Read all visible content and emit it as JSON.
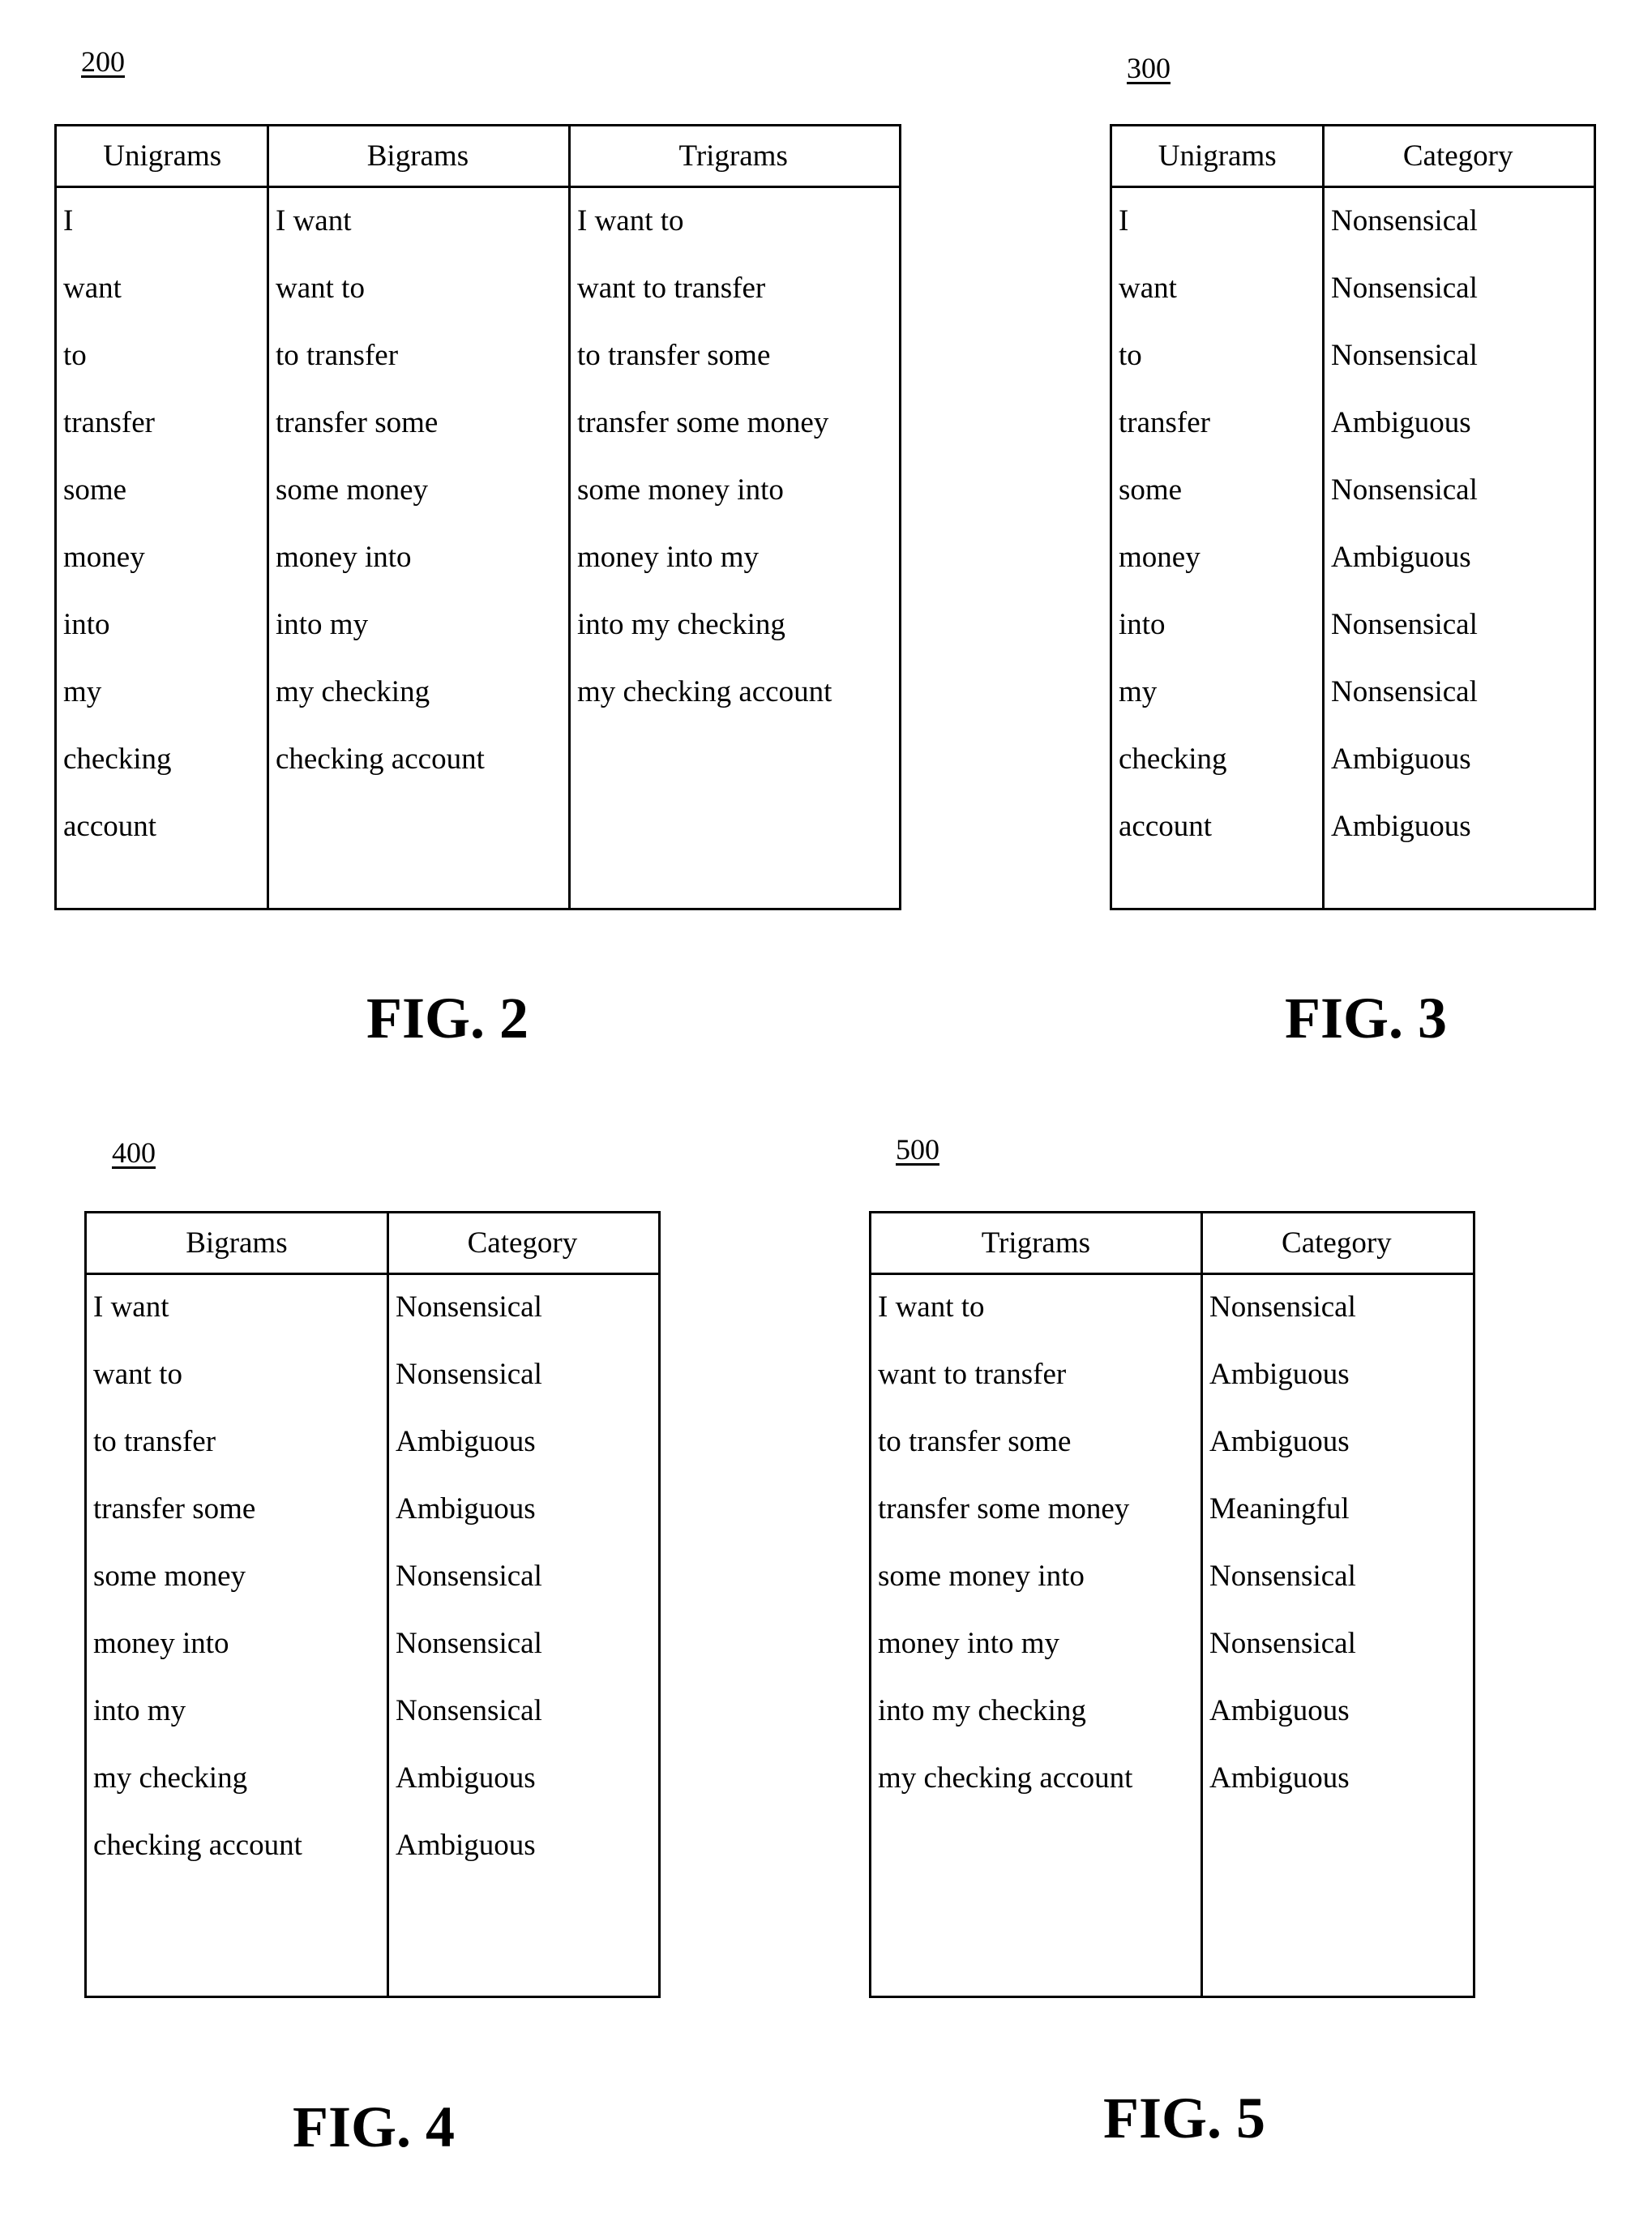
{
  "figures": [
    {
      "ref": "200",
      "caption": "FIG. 2",
      "headers": [
        "Unigrams",
        "Bigrams",
        "Trigrams"
      ],
      "columns": [
        [
          "I",
          "want",
          "to",
          "transfer",
          "some",
          "money",
          "into",
          "my",
          "checking",
          "account"
        ],
        [
          "I want",
          "want to",
          "to transfer",
          "transfer some",
          "some money",
          "money into",
          "into my",
          "my checking",
          "checking account"
        ],
        [
          "I want to",
          "want to transfer",
          "to transfer some",
          "transfer some money",
          "some money into",
          "money into my",
          "into my checking",
          "my checking account"
        ]
      ]
    },
    {
      "ref": "300",
      "caption": "FIG. 3",
      "headers": [
        "Unigrams",
        "Category"
      ],
      "columns": [
        [
          "I",
          "want",
          "to",
          "transfer",
          "some",
          "money",
          "into",
          "my",
          "checking",
          "account"
        ],
        [
          "Nonsensical",
          "Nonsensical",
          "Nonsensical",
          "Ambiguous",
          "Nonsensical",
          "Ambiguous",
          "Nonsensical",
          "Nonsensical",
          "Ambiguous",
          "Ambiguous"
        ]
      ]
    },
    {
      "ref": "400",
      "caption": "FIG. 4",
      "headers": [
        "Bigrams",
        "Category"
      ],
      "columns": [
        [
          "I want",
          "want to",
          "to transfer",
          "transfer some",
          "some money",
          "money into",
          "into my",
          "my checking",
          "checking account"
        ],
        [
          "Nonsensical",
          "Nonsensical",
          "Ambiguous",
          "Ambiguous",
          "Nonsensical",
          "Nonsensical",
          "Nonsensical",
          "Ambiguous",
          "Ambiguous"
        ]
      ]
    },
    {
      "ref": "500",
      "caption": "FIG. 5",
      "headers": [
        "Trigrams",
        "Category"
      ],
      "columns": [
        [
          "I want to",
          "want to transfer",
          "to transfer some",
          "transfer some money",
          "some money into",
          "money into my",
          "into my checking",
          "my checking account"
        ],
        [
          "Nonsensical",
          "Ambiguous",
          "Ambiguous",
          "Meaningful",
          "Nonsensical",
          "Nonsensical",
          "Ambiguous",
          "Ambiguous"
        ]
      ]
    }
  ]
}
